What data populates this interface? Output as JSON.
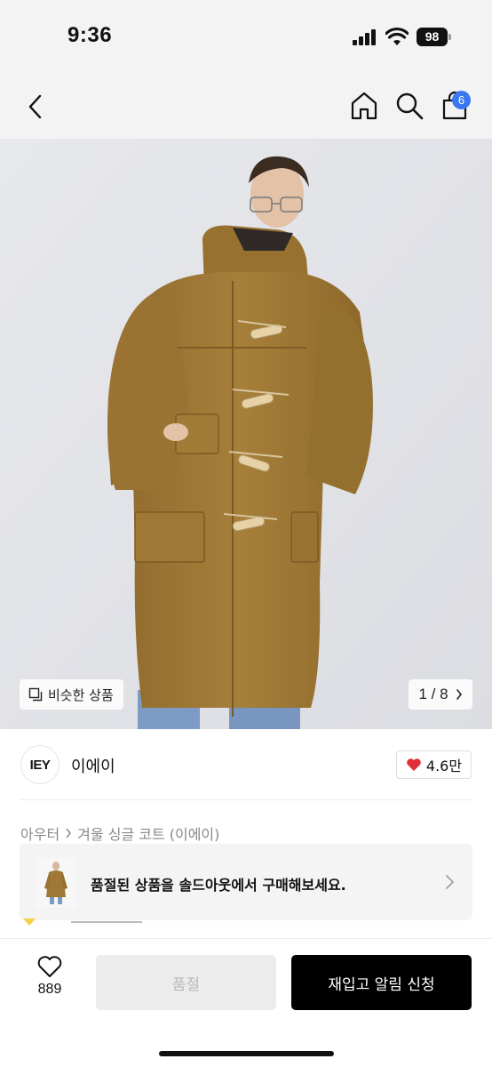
{
  "status_bar": {
    "time": "9:36",
    "battery": "98"
  },
  "header": {
    "back_icon": "chevron-left-icon",
    "home_icon": "home-icon",
    "search_icon": "search-icon",
    "cart_icon": "shopping-bag-icon",
    "cart_count": "6"
  },
  "gallery": {
    "similar_label": "비슷한 상품",
    "pager": "1 / 8"
  },
  "brand": {
    "logo_text": "IEY",
    "name": "이에이",
    "likes": "4.6만"
  },
  "breadcrumb": {
    "category": "아우터",
    "product": "겨울 싱글 코트 (이에이)"
  },
  "soldout_banner": {
    "text": "품절된 상품을 솔드아웃에서 구매해보세요."
  },
  "bottom_bar": {
    "wish_count": "889",
    "soldout_label": "품절",
    "notify_label": "재입고 알림 신청"
  },
  "colors": {
    "accent_badge": "#3a78f2",
    "heart": "#e02f3b",
    "primary_button": "#000000",
    "coat": "#a07a35"
  }
}
